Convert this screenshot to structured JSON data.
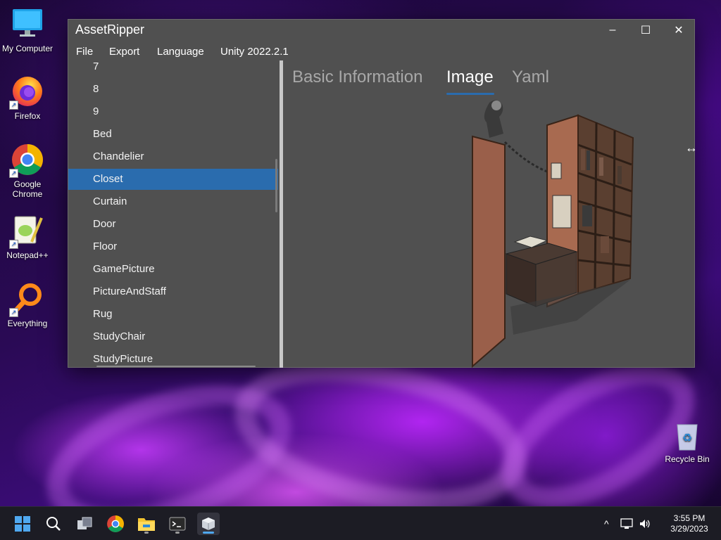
{
  "desktop": {
    "icons": [
      {
        "label": "My Computer"
      },
      {
        "label": "Firefox"
      },
      {
        "label": "Google Chrome"
      },
      {
        "label": "Notepad++"
      },
      {
        "label": "Everything"
      }
    ],
    "recycle_bin": {
      "label": "Recycle Bin"
    }
  },
  "window": {
    "title": "AssetRipper",
    "controls": {
      "minimize": "–",
      "maximize": "☐",
      "close": "✕"
    },
    "menu": [
      {
        "label": "File"
      },
      {
        "label": "Export"
      },
      {
        "label": "Language"
      },
      {
        "label": "Unity 2022.2.1"
      }
    ],
    "asset_list": [
      {
        "label": "7"
      },
      {
        "label": "8"
      },
      {
        "label": "9"
      },
      {
        "label": "Bed"
      },
      {
        "label": "Chandelier"
      },
      {
        "label": "Closet",
        "selected": true
      },
      {
        "label": "Curtain"
      },
      {
        "label": "Door"
      },
      {
        "label": "Floor"
      },
      {
        "label": "GamePicture"
      },
      {
        "label": "PictureAndStaff"
      },
      {
        "label": "Rug"
      },
      {
        "label": "StudyChair"
      },
      {
        "label": "StudyPicture"
      }
    ],
    "tabs": [
      {
        "label": "Basic Information"
      },
      {
        "label": "Image",
        "active": true
      },
      {
        "label": "Yaml"
      }
    ],
    "accent_color": "#2a6cae"
  },
  "taskbar": {
    "apps": [
      {
        "icon": "windows-start-icon"
      },
      {
        "icon": "search-icon"
      },
      {
        "icon": "task-view-icon"
      },
      {
        "icon": "chrome-icon"
      },
      {
        "icon": "file-explorer-icon"
      },
      {
        "icon": "terminal-icon"
      },
      {
        "icon": "assetripper-icon"
      }
    ],
    "tray": {
      "chevron": "^"
    },
    "clock": {
      "time": "3:55 PM",
      "date": "3/29/2023"
    }
  }
}
